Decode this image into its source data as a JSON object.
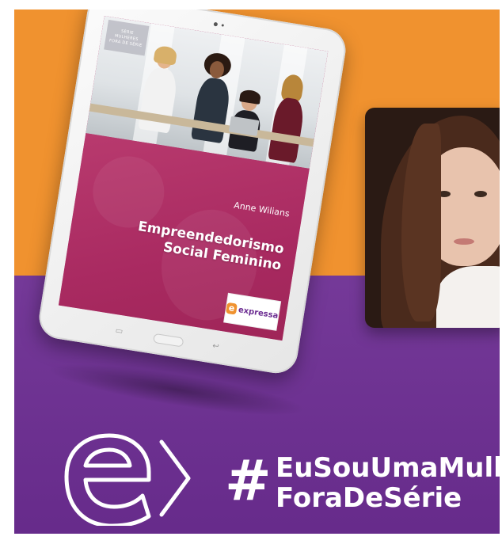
{
  "book": {
    "series_tag": [
      "SÉRIE",
      "MULHERES",
      "FORA DE SÉRIE"
    ],
    "author": "Anne Wilians",
    "title_line1": "Empreendedorismo",
    "title_line2": "Social Feminino",
    "publisher": "expressa"
  },
  "campaign": {
    "hashtag_symbol": "#",
    "hashtag_line1": "EuSouUmaMulher",
    "hashtag_line2": "ForaDeSérie"
  },
  "colors": {
    "orange": "#f0922f",
    "purple": "#6c2d92",
    "book_pink": "#b23168"
  },
  "icons": {
    "brand_mark": "expressa-e-arrow-logo",
    "tablet_back": "back-button-icon",
    "tablet_recent": "recent-apps-icon"
  }
}
